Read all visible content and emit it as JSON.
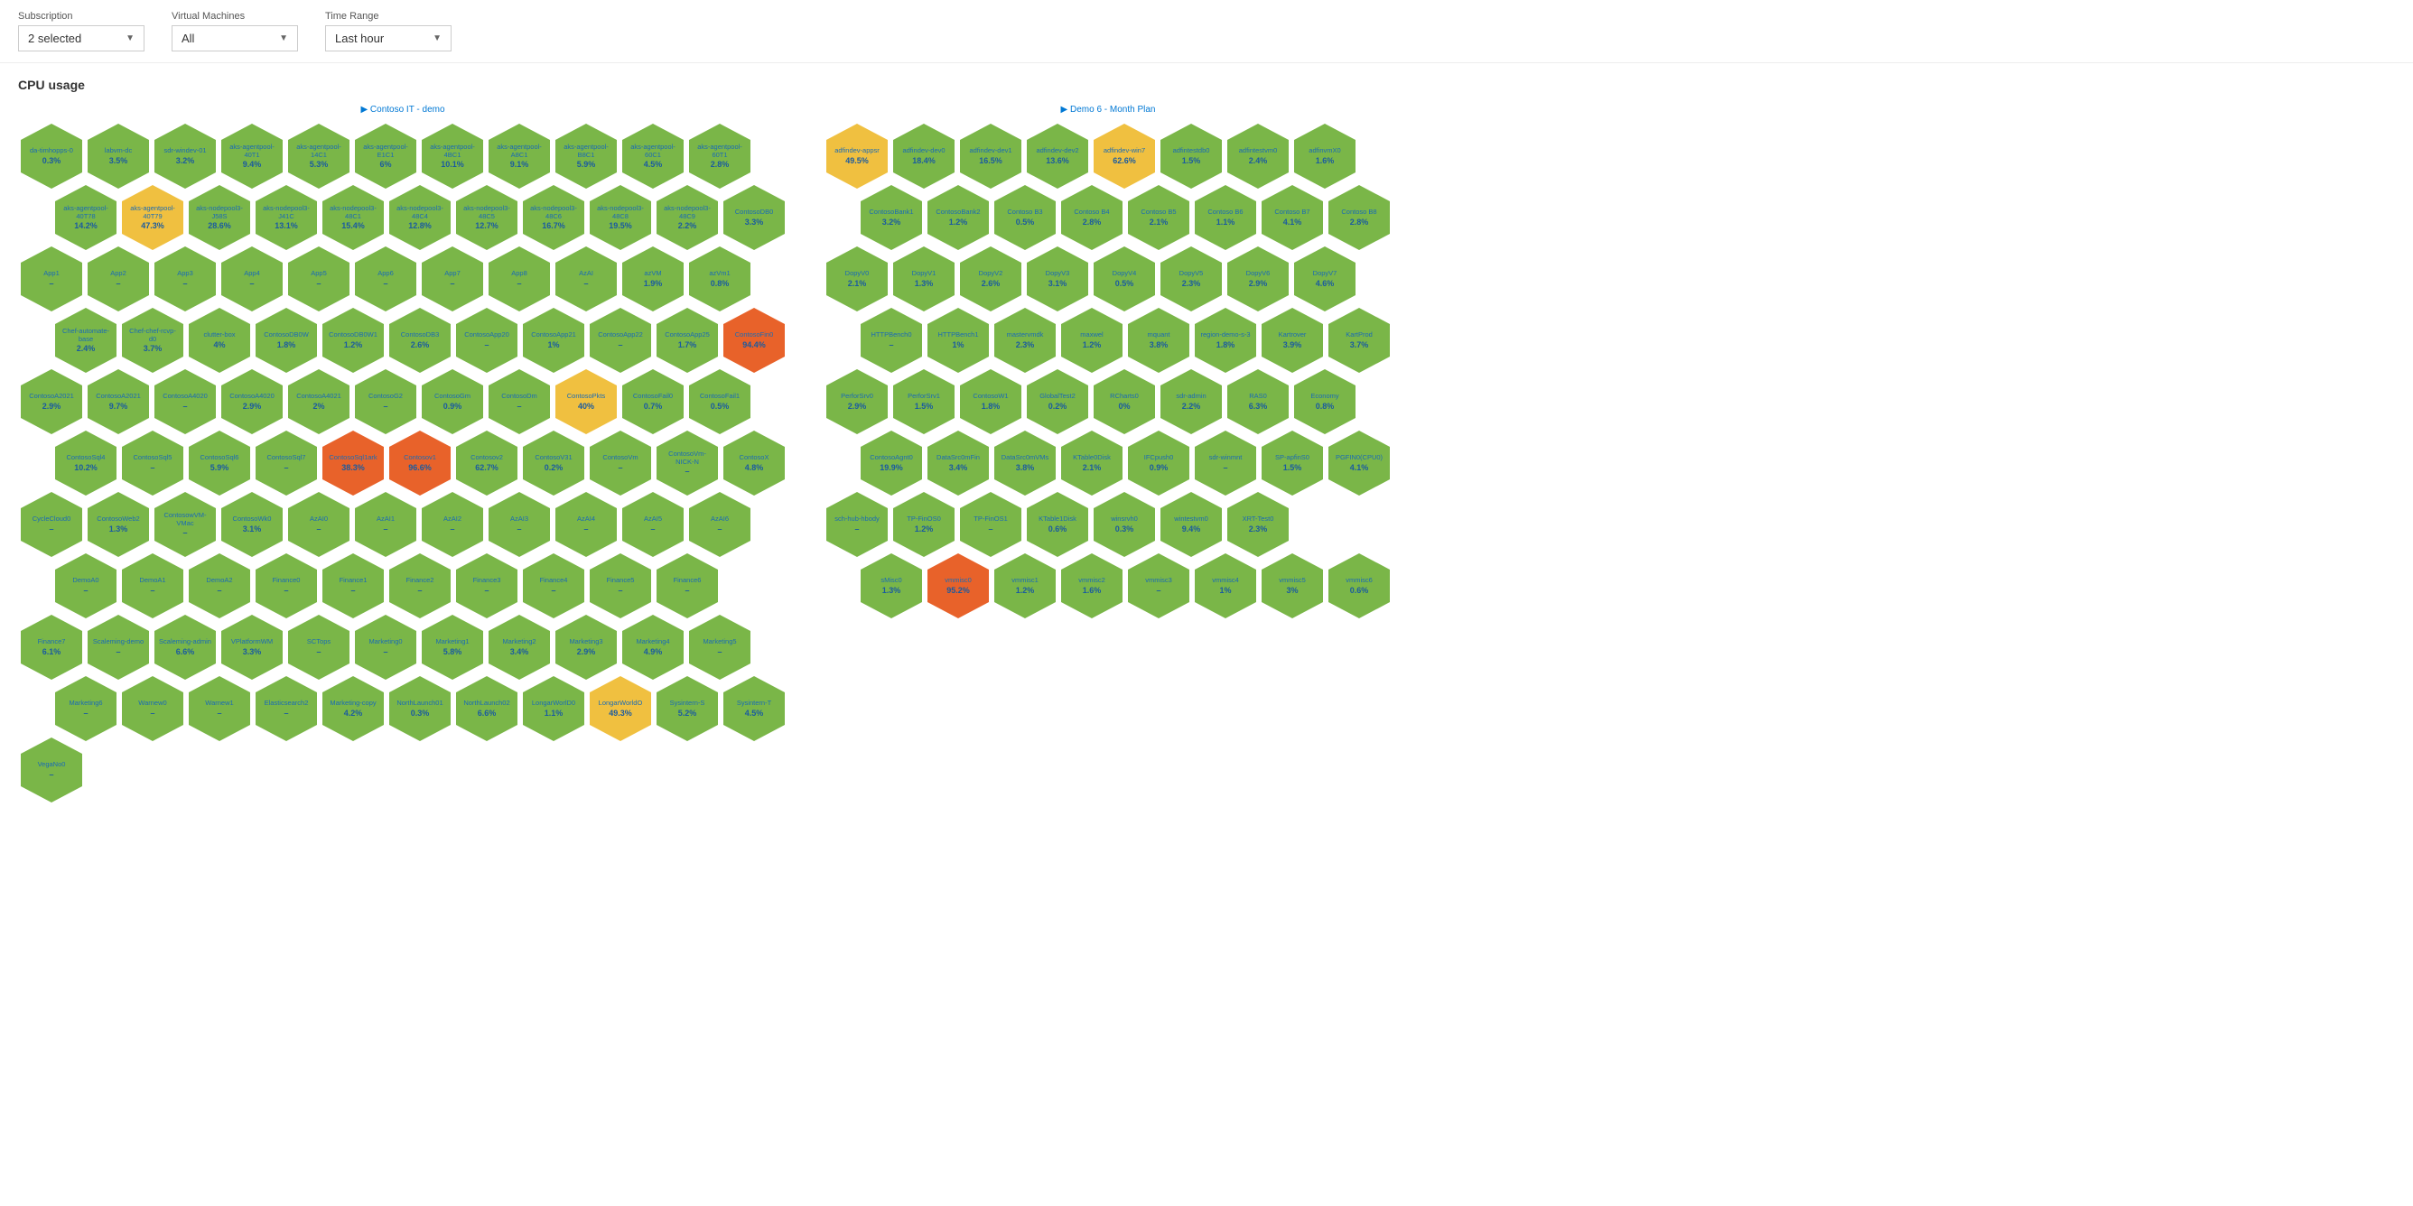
{
  "header": {
    "subscription_label": "Subscription",
    "subscription_value": "2 selected",
    "vm_label": "Virtual Machines",
    "vm_value": "All",
    "time_label": "Time Range",
    "time_value": "Last hour"
  },
  "section": {
    "title": "CPU usage"
  },
  "charts": {
    "left_label": "Contoso IT - demo",
    "right_label": "Demo 6 - Month Plan"
  }
}
